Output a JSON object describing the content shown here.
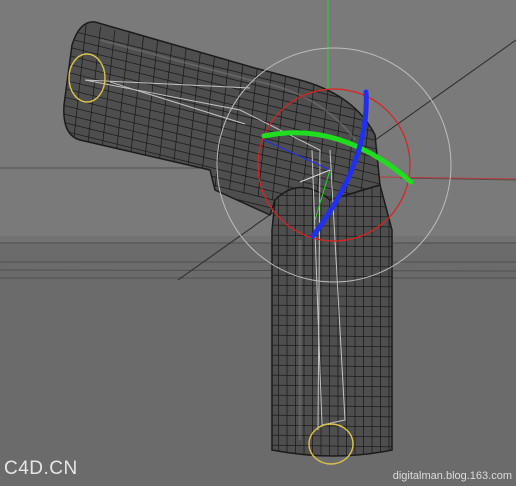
{
  "viewport": {
    "name": "c4d-3d-viewport",
    "background_color": "#7a7a7a",
    "ground_color": "#6b6b6b",
    "horizon_line_color": "#555555",
    "mesh_fill_color": "#4d4d4d",
    "mesh_wire_color": "#1b1b1b",
    "axis_colors": {
      "x": "#ff0000",
      "y": "#33cc33",
      "z": "#2233ff"
    }
  },
  "object": {
    "type": "bent-pipe-mesh",
    "selected_joint_gizmo": {
      "ring_colors": {
        "x": "#e02020",
        "y": "#20dd20",
        "z": "#2030ee"
      },
      "outer_ring_color": "#bdbdbd"
    },
    "end_handles_color": "#d9c24a"
  },
  "watermark": {
    "brand": "C4D.CN",
    "credit": "digitalman.blog.163.com"
  }
}
